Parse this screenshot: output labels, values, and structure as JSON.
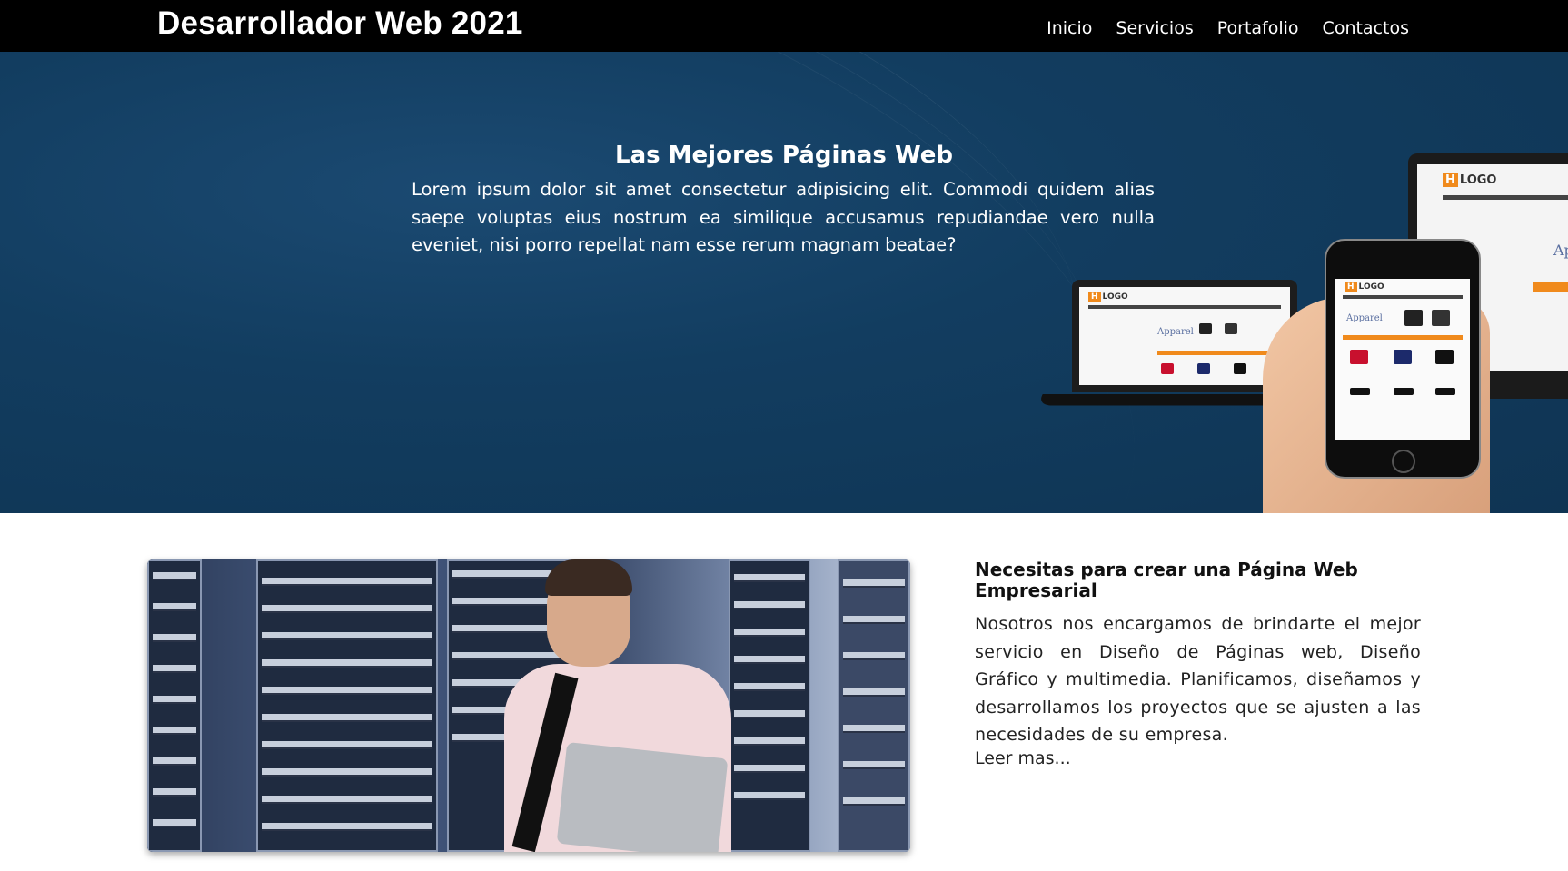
{
  "header": {
    "brand": "Desarrollador Web 2021",
    "nav": [
      "Inicio",
      "Servicios",
      "Portafolio",
      "Contactos"
    ]
  },
  "hero": {
    "title": "Las Mejores Páginas Web",
    "text": "Lorem ipsum dolor sit amet consectetur adipisicing elit. Commodi quidem alias saepe voluptas eius nostrum ea similique accusamus repudiandae vero nulla eveniet, nisi porro repellat nam esse rerum magnam beatae?",
    "mockup": {
      "logo_text": "LOGO",
      "apparel_text": "Apparel"
    }
  },
  "section": {
    "title": "Necesitas para crear una Página Web Empresarial",
    "text": "Nosotros nos encargamos de brindarte el mejor servicio en Diseño de Páginas web, Diseño Gráfico y multimedia. Planificamos, diseñamos y desarrollamos los proyectos que se ajusten a las necesidades de su empresa.",
    "read_more": "Leer mas..."
  },
  "colors": {
    "topbar": "#000000",
    "hero_bg": "#123d60",
    "accent_orange": "#f08a1c"
  }
}
